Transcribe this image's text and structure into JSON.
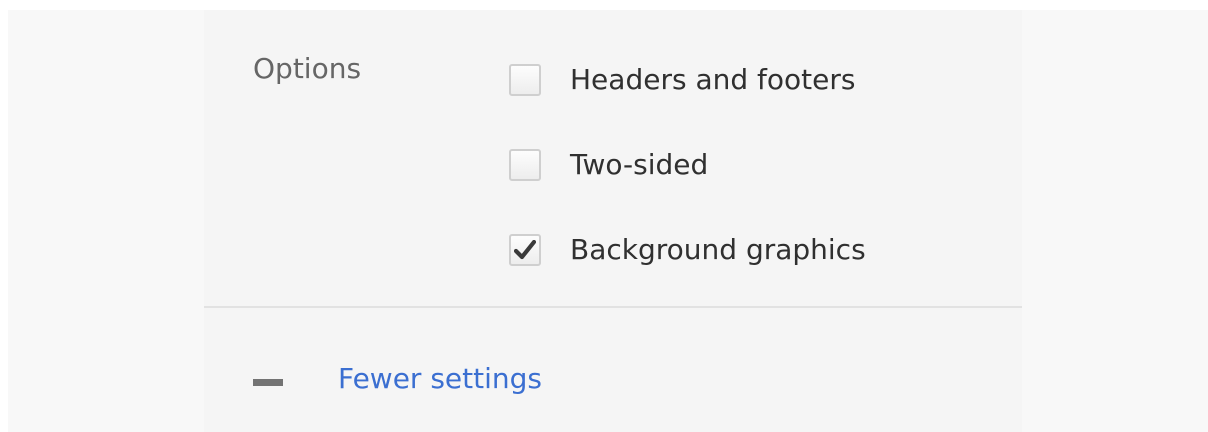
{
  "options": {
    "label": "Options",
    "items": [
      {
        "label": "Headers and footers",
        "checked": false
      },
      {
        "label": "Two-sided",
        "checked": false
      },
      {
        "label": "Background graphics",
        "checked": true
      }
    ]
  },
  "footer": {
    "toggle_label": "Fewer settings",
    "toggle_icon": "minus-icon"
  },
  "colors": {
    "link": "#3b6fd1",
    "text": "#303030",
    "muted_text": "#666666",
    "panel_background": "#f5f5f5",
    "divider": "#e2e2e2"
  }
}
